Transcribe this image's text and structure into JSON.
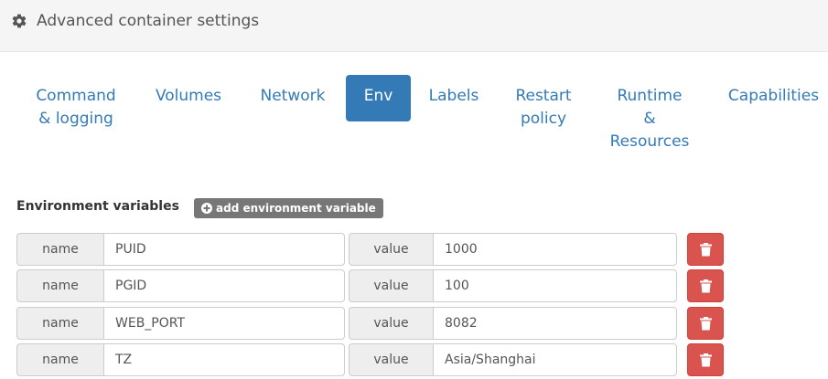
{
  "header": {
    "title": "Advanced container settings",
    "icon": "gear-icon"
  },
  "tabs": [
    {
      "label": "Command\n& logging",
      "active": false
    },
    {
      "label": "Volumes",
      "active": false
    },
    {
      "label": "Network",
      "active": false
    },
    {
      "label": "Env",
      "active": true
    },
    {
      "label": "Labels",
      "active": false
    },
    {
      "label": "Restart\npolicy",
      "active": false
    },
    {
      "label": "Runtime\n&\nResources",
      "active": false
    },
    {
      "label": "Capabilities",
      "active": false
    }
  ],
  "env": {
    "section_label": "Environment variables",
    "add_button_label": "add environment variable",
    "name_addon": "name",
    "value_addon": "value",
    "variables": [
      {
        "name": "PUID",
        "value": "1000"
      },
      {
        "name": "PGID",
        "value": "100"
      },
      {
        "name": "WEB_PORT",
        "value": "8082"
      },
      {
        "name": "TZ",
        "value": "Asia/Shanghai"
      }
    ]
  },
  "colors": {
    "primary": "#337ab7",
    "danger": "#d9534f",
    "muted_button": "#777777"
  }
}
